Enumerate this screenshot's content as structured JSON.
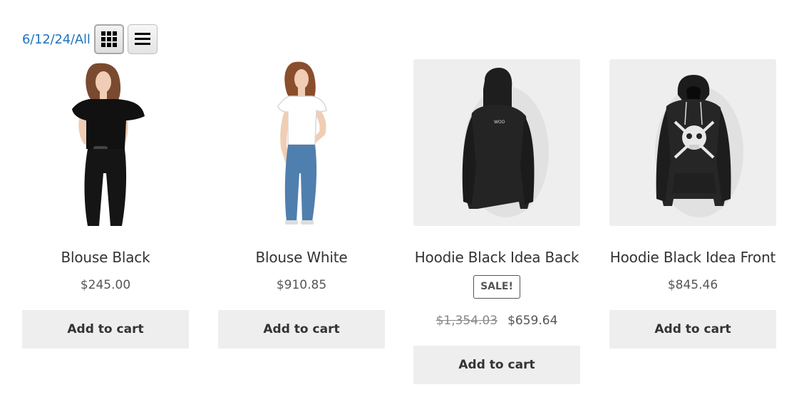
{
  "toolbar": {
    "per_page": [
      "6",
      "12",
      "24",
      "All"
    ],
    "separator": "/",
    "grid_view": "grid-view-icon",
    "list_view": "list-view-icon"
  },
  "products": [
    {
      "title": "Blouse Black",
      "price": "$245.00",
      "button": "Add to cart",
      "image": "blouse-black-image"
    },
    {
      "title": "Blouse White",
      "price": "$910.85",
      "button": "Add to cart",
      "image": "blouse-white-image"
    },
    {
      "title": "Hoodie Black Idea Back",
      "badge": "SALE!",
      "old_price": "$1,354.03",
      "price": "$659.64",
      "button": "Add to cart",
      "image": "hoodie-back-image"
    },
    {
      "title": "Hoodie Black Idea Front",
      "price": "$845.46",
      "button": "Add to cart",
      "image": "hoodie-front-image"
    }
  ],
  "colors": {
    "link": "#1e73be",
    "button_bg": "#eeeeee",
    "text": "#333333"
  }
}
